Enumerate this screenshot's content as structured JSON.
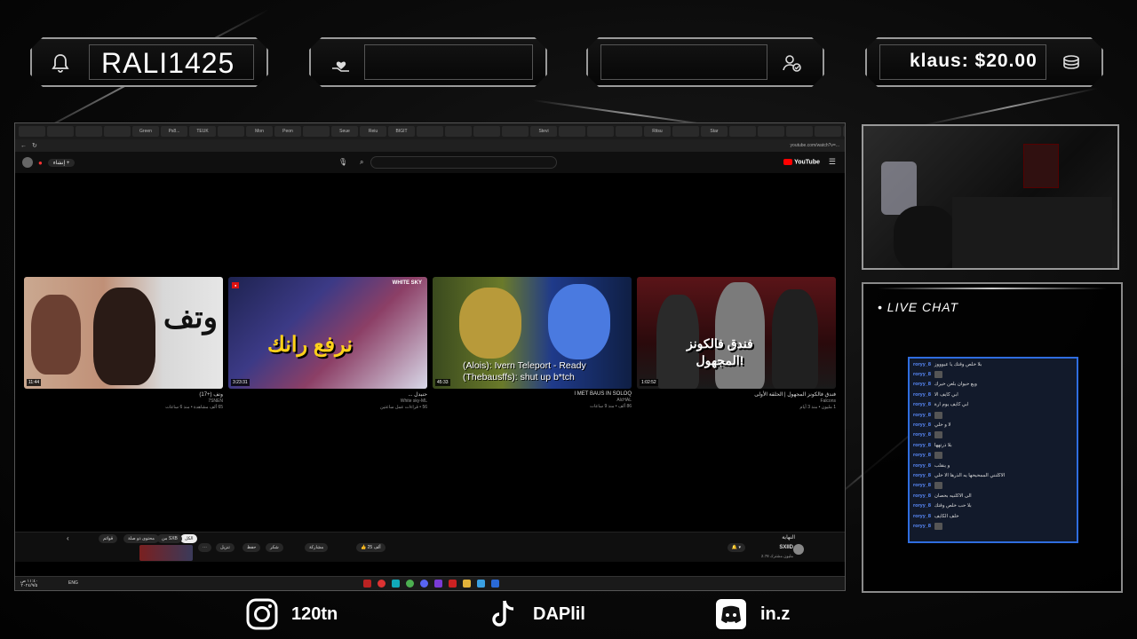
{
  "overlay": {
    "follower_name": "RALI1425",
    "donation_text": "klaus: $20.00",
    "live_chat_title": "LIVE CHAT",
    "icons": [
      "bell-icon",
      "heart-hand-icon",
      "subscribe-icon",
      "coins-icon"
    ]
  },
  "browser": {
    "url": "youtube.com/watch?v=...",
    "search_placeholder": "",
    "logo": "YouTube",
    "tabs": [
      "",
      "",
      "",
      "",
      "Green",
      "Ps8...",
      "TEUK",
      "",
      "Mon",
      "Peon",
      "",
      "Seue",
      "Reiu",
      "BIGIT",
      "",
      "",
      "",
      "",
      "Stevi",
      "",
      "",
      "",
      "Ritsu",
      "",
      "Star",
      "",
      "",
      "",
      "",
      "",
      "",
      "",
      "",
      "",
      ""
    ],
    "videos": [
      {
        "title": "وتف (+17)",
        "channel": "7SNEN",
        "meta": "65 ألف مشاهدة • منذ 6 ساعات",
        "duration": "11:44",
        "thumb_text": "وتف"
      },
      {
        "title": "حنيدل ...",
        "channel": "White sky-ML",
        "meta": "56 • قراءات عمل ساعتين",
        "duration": "3:23:31",
        "thumb_text": "نرفع رانك",
        "badge": "WHITE SKY"
      },
      {
        "title": "I MET BAUS IN SOLOQ",
        "channel": "AlcHAL",
        "meta": "86 ألف • منذ 9 ساعات",
        "duration": "45:33",
        "thumb_text": "(Alois): Ivern Teleport - Ready\n(Thebausffs): shut up b*tch"
      },
      {
        "title": "فندق فالكونز المجهول | الحلقة الأولى",
        "channel": "Falcons",
        "meta": "1 مليون • منذ 3 أيام",
        "duration": "1:02:52",
        "thumb_text": "فندق فالكونز\nالمجهول!"
      }
    ],
    "player": {
      "channel": "SXIID",
      "subs": "2.78 مليون مشترك",
      "like_count": "25 ألف",
      "buttons": [
        "مشاركة",
        "تنزيل",
        "حفظ",
        "شكر"
      ],
      "video_name": "النهاية",
      "chips": [
        "الكل",
        "من SXB",
        "محتوى ذو صلة",
        "قوائم"
      ]
    },
    "taskbar": {
      "lang": "ENG",
      "time": "١١:٤٠ ص",
      "date": "٢٠٢٤/٩/٥"
    }
  },
  "chat": {
    "messages": [
      {
        "user": "roryy_8",
        "text": "بلا خلص وقتك يا عيوووز"
      },
      {
        "user": "roryy_8",
        "text": ""
      },
      {
        "user": "roryy_8",
        "text": "ويع حيوان بلعن خيرك"
      },
      {
        "user": "roryy_8",
        "text": "ابي كايف الا"
      },
      {
        "user": "roryy_8",
        "text": "ابي كايف يوم ارة"
      },
      {
        "user": "roryy_8",
        "text": ""
      },
      {
        "user": "roryy_8",
        "text": "لا و خلي"
      },
      {
        "user": "roryy_8",
        "text": ""
      },
      {
        "user": "roryy_8",
        "text": "بلا ذرتهها"
      },
      {
        "user": "roryy_8",
        "text": ""
      },
      {
        "user": "roryy_8",
        "text": "و ينقلب"
      },
      {
        "user": "roryy_8",
        "text": "الاكلنني الممحيحها يه الذرها الا خلي"
      },
      {
        "user": "roryy_8",
        "text": ""
      },
      {
        "user": "roryy_8",
        "text": "الى الاكلنيه بحصان"
      },
      {
        "user": "roryy_8",
        "text": "بلا حب خلص وقتك"
      },
      {
        "user": "roryy_8",
        "text": "خلف الكايف"
      },
      {
        "user": "roryy_8",
        "text": ""
      }
    ]
  },
  "socials": [
    {
      "icon": "instagram-icon",
      "handle": "120tn"
    },
    {
      "icon": "tiktok-icon",
      "handle": "DAPlil"
    },
    {
      "icon": "discord-icon",
      "handle": "in.z"
    }
  ],
  "colors": {
    "accent": "#2f6de0",
    "chat_user": "#5a8cff",
    "youtube_red": "#ff0000"
  }
}
